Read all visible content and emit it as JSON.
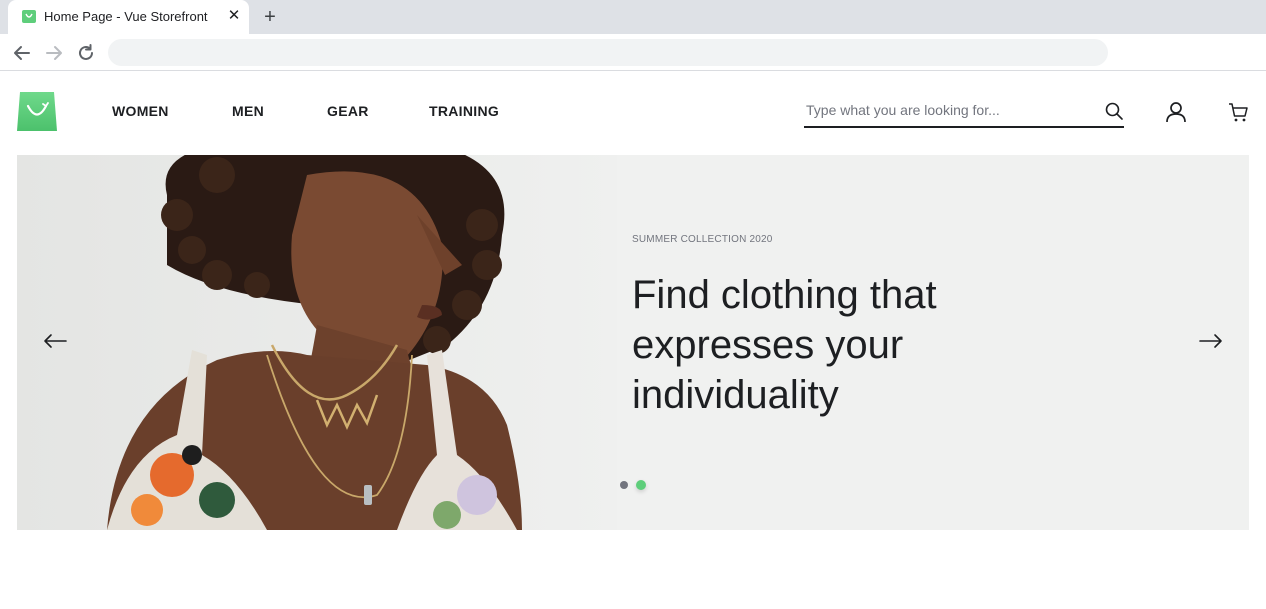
{
  "browser": {
    "tab_title": "Home Page - Vue Storefront",
    "close_glyph": "✕",
    "new_tab_glyph": "+",
    "address": ""
  },
  "header": {
    "nav": [
      "WOMEN",
      "MEN",
      "GEAR",
      "TRAINING"
    ],
    "search_placeholder": "Type what you are looking for..."
  },
  "hero": {
    "subtitle": "SUMMER COLLECTION 2020",
    "title": "Find clothing that expresses your individuality",
    "slide_count": 2,
    "active_slide": 2
  },
  "colors": {
    "brand_green": "#5ece7b",
    "hero_background": "#f0f1f0",
    "text_primary": "#1d1f22",
    "text_secondary": "#72757e"
  },
  "icons": [
    "storefront-logo-icon",
    "back-arrow-icon",
    "forward-arrow-icon",
    "reload-icon",
    "search-icon",
    "account-icon",
    "cart-icon",
    "arrow-left-icon",
    "arrow-right-icon"
  ]
}
